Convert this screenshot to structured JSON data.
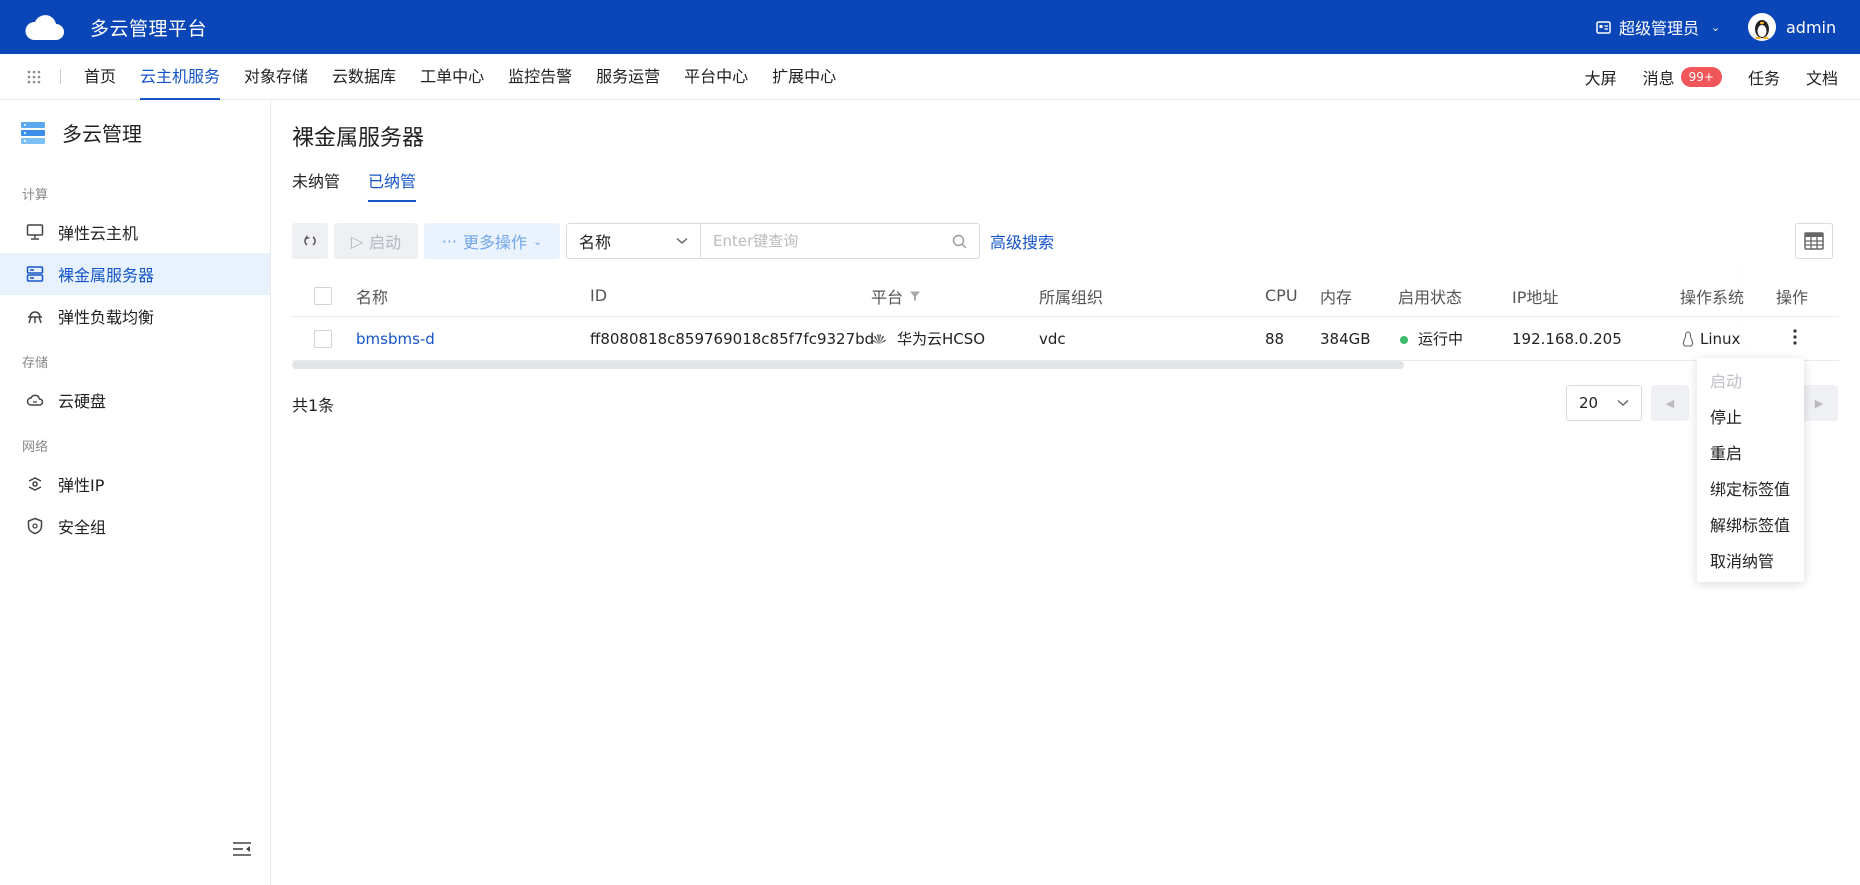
{
  "header": {
    "app_title": "多云管理平台",
    "role_label": "超级管理员",
    "user_name": "admin"
  },
  "nav": {
    "items": [
      "首页",
      "云主机服务",
      "对象存储",
      "云数据库",
      "工单中心",
      "监控告警",
      "服务运营",
      "平台中心",
      "扩展中心"
    ],
    "active_index": 1,
    "right": {
      "screen": "大屏",
      "messages": "消息",
      "message_badge": "99+",
      "tasks": "任务",
      "docs": "文档"
    }
  },
  "sidebar": {
    "title": "多云管理",
    "groups": {
      "compute": "计算",
      "storage": "存储",
      "network": "网络"
    },
    "items": [
      {
        "label": "弹性云主机",
        "icon": "monitor-icon"
      },
      {
        "label": "裸金属服务器",
        "icon": "server-icon"
      },
      {
        "label": "弹性负载均衡",
        "icon": "load-balancer-icon"
      },
      {
        "label": "云硬盘",
        "icon": "cloud-disk-icon"
      },
      {
        "label": "弹性IP",
        "icon": "elastic-ip-icon"
      },
      {
        "label": "安全组",
        "icon": "shield-icon"
      }
    ],
    "active_index": 1
  },
  "main": {
    "page_title": "裸金属服务器",
    "tabs": [
      "未纳管",
      "已纳管"
    ],
    "active_tab": 1,
    "toolbar": {
      "start_label": "启动",
      "more_label": "更多操作",
      "search_field": "名称",
      "search_placeholder": "Enter键查询",
      "advanced_search": "高级搜索"
    },
    "table": {
      "headers": {
        "name": "名称",
        "id": "ID",
        "platform": "平台",
        "org": "所属组织",
        "cpu": "CPU",
        "memory": "内存",
        "status": "启用状态",
        "ip": "IP地址",
        "os": "操作系统",
        "ops": "操作"
      },
      "rows": [
        {
          "name": "bmsbms-d",
          "id": "ff8080818c859769018c85f7fc9327bd",
          "platform": "华为云HCSO",
          "org": "vdc",
          "cpu": "88",
          "memory": "384GB",
          "status": "运行中",
          "ip": "192.168.0.205",
          "os": "Linux"
        }
      ]
    },
    "total": "共1条",
    "page_size": "20"
  },
  "row_menu": {
    "items": [
      {
        "label": "启动",
        "disabled": true
      },
      {
        "label": "停止",
        "disabled": false
      },
      {
        "label": "重启",
        "disabled": false
      },
      {
        "label": "绑定标签值",
        "disabled": false
      },
      {
        "label": "解绑标签值",
        "disabled": false
      },
      {
        "label": "取消纳管",
        "disabled": false
      }
    ]
  },
  "colors": {
    "header_bg": "#0b46b8",
    "accent": "#1555c9",
    "status_running": "#3cbb6b",
    "badge": "#f0565a"
  }
}
